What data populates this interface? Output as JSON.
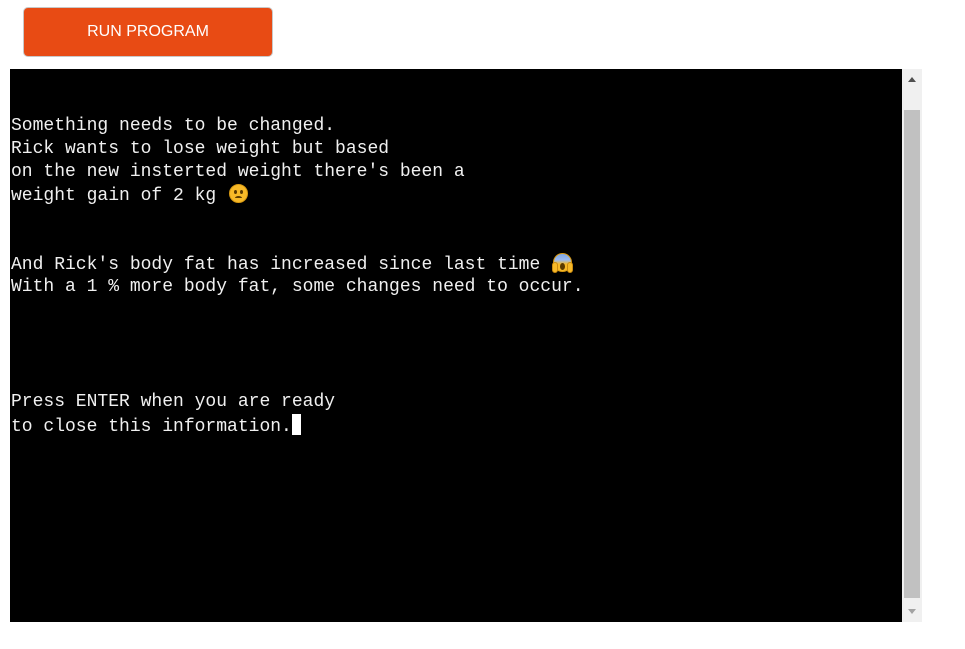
{
  "toolbar": {
    "run_label": "RUN PROGRAM",
    "accent_color": "#e84b14"
  },
  "terminal": {
    "background": "#000000",
    "text_color": "#f0f0f0",
    "lines": [
      "Something needs to be changed.",
      "Rick wants to lose weight but based",
      "on the new insterted weight there's been a",
      "weight gain of 2 kg ",
      "",
      "",
      "And Rick's body fat has increased since last time ",
      "With a 1 % more body fat, some changes need to occur.",
      "",
      "",
      "",
      "",
      "Press ENTER when you are ready",
      "to close this information."
    ],
    "emojis": {
      "line_4": "frowning-face-emoji",
      "line_7": "face-screaming-in-fear-emoji"
    },
    "cursor": "block-cursor"
  },
  "scrollbar": {
    "up_icon": "scroll-up-arrow-icon",
    "down_icon": "scroll-down-arrow-icon"
  }
}
